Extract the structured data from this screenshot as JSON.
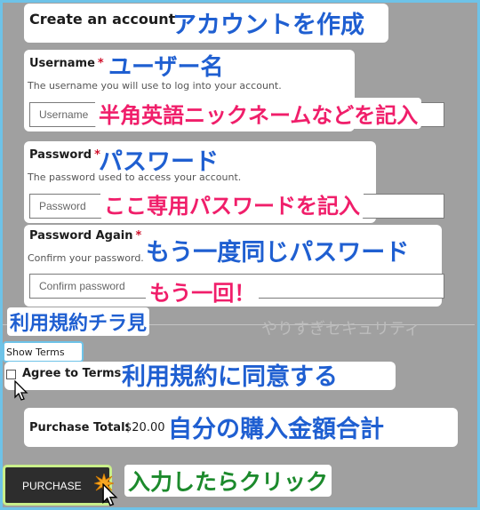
{
  "form": {
    "title": "Create an account",
    "username": {
      "label": "Username",
      "required_mark": "*",
      "hint": "The username you will use to log into your account.",
      "placeholder": "Username"
    },
    "password": {
      "label": "Password",
      "required_mark": "*",
      "hint": "The password used to access your account.",
      "placeholder": "Password"
    },
    "password_again": {
      "label": "Password Again",
      "required_mark": "*",
      "hint": "Confirm your password.",
      "placeholder": "Confirm password"
    },
    "show_terms_label": "Show Terms",
    "agree_label": "Agree to Terms",
    "purchase_total_label": "Purchase Total:",
    "purchase_total_value": "$20.00",
    "purchase_button": "PURCHASE"
  },
  "annotations": {
    "title": "アカウントを作成",
    "username": "ユーザー名",
    "username_note": "半角英語ニックネームなどを記入",
    "password": "パスワード",
    "password_note": "ここ専用パスワードを記入",
    "password_again": "もう一度同じパスワード",
    "password_again_note": "もう一回！",
    "terms": "利用規約チラ見",
    "security": "やりすぎセキュリティ",
    "agree": "利用規約に同意する",
    "total": "自分の購入金額合計",
    "purchase": "入力したらクリック"
  },
  "colors": {
    "annotation_blue": "#1f5fd1",
    "annotation_pink": "#f01e6a",
    "annotation_green": "#1c8a2c",
    "frame_border": "#6ec3e8",
    "button_bg": "#2d2d2d"
  },
  "icons": [
    "pointer-cursor-icon",
    "click-burst-icon",
    "checkbox-icon"
  ]
}
